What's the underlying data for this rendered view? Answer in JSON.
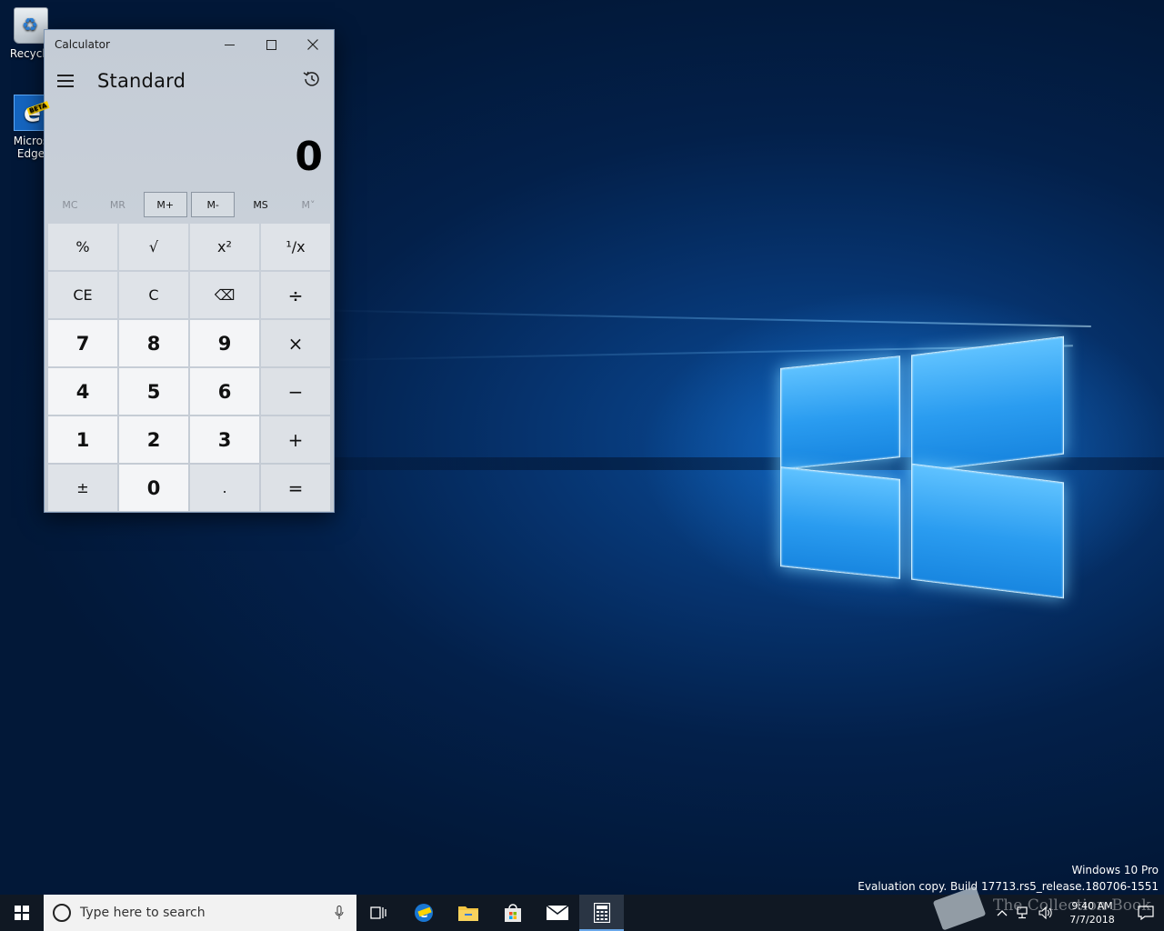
{
  "desktop": {
    "icons": [
      {
        "label": "Recycle",
        "icon": "recycle-bin-icon"
      },
      {
        "label_line1": "Micros",
        "label_line2": "Edge",
        "badge": "BETA",
        "icon": "edge-icon"
      }
    ],
    "watermark": {
      "line1": "Windows 10 Pro",
      "line2": "Evaluation copy. Build 17713.rs5_release.180706-1551"
    }
  },
  "calculator": {
    "window_title": "Calculator",
    "mode": "Standard",
    "display": "0",
    "memory": [
      {
        "label": "MC",
        "enabled": false
      },
      {
        "label": "MR",
        "enabled": false
      },
      {
        "label": "M+",
        "enabled": true
      },
      {
        "label": "M-",
        "enabled": true
      },
      {
        "label": "MS",
        "enabled": true
      },
      {
        "label": "M˅",
        "enabled": false
      }
    ],
    "keys": [
      {
        "label": "%",
        "kind": "fn",
        "name": "percent-key"
      },
      {
        "label": "√",
        "kind": "fn",
        "name": "square-root-key"
      },
      {
        "label": "x²",
        "kind": "fn",
        "name": "square-key"
      },
      {
        "label": "¹/x",
        "kind": "fn",
        "name": "reciprocal-key"
      },
      {
        "label": "CE",
        "kind": "fn",
        "name": "clear-entry-key"
      },
      {
        "label": "C",
        "kind": "fn",
        "name": "clear-key"
      },
      {
        "label": "⌫",
        "kind": "fn",
        "name": "backspace-key"
      },
      {
        "label": "÷",
        "kind": "op",
        "name": "divide-key"
      },
      {
        "label": "7",
        "kind": "num",
        "name": "digit-7-key"
      },
      {
        "label": "8",
        "kind": "num",
        "name": "digit-8-key"
      },
      {
        "label": "9",
        "kind": "num",
        "name": "digit-9-key"
      },
      {
        "label": "×",
        "kind": "op",
        "name": "multiply-key"
      },
      {
        "label": "4",
        "kind": "num",
        "name": "digit-4-key"
      },
      {
        "label": "5",
        "kind": "num",
        "name": "digit-5-key"
      },
      {
        "label": "6",
        "kind": "num",
        "name": "digit-6-key"
      },
      {
        "label": "−",
        "kind": "op",
        "name": "subtract-key"
      },
      {
        "label": "1",
        "kind": "num",
        "name": "digit-1-key"
      },
      {
        "label": "2",
        "kind": "num",
        "name": "digit-2-key"
      },
      {
        "label": "3",
        "kind": "num",
        "name": "digit-3-key"
      },
      {
        "label": "+",
        "kind": "op",
        "name": "add-key"
      },
      {
        "label": "±",
        "kind": "fn",
        "name": "negate-key"
      },
      {
        "label": "0",
        "kind": "num",
        "name": "digit-0-key"
      },
      {
        "label": ".",
        "kind": "fn",
        "name": "decimal-key"
      },
      {
        "label": "=",
        "kind": "op",
        "name": "equals-key"
      }
    ]
  },
  "taskbar": {
    "search_placeholder": "Type here to search",
    "pinned": [
      "task-view-icon",
      "edge-beta-icon",
      "file-explorer-icon",
      "store-icon",
      "mail-icon",
      "calculator-icon"
    ],
    "active_app": "calculator-icon",
    "clock_time": "9:40 AM",
    "clock_date": "7/7/2018",
    "overlay_text": "The Collection Book"
  },
  "colors": {
    "accent": "#6aa8ea",
    "taskbar": "#101823",
    "calc_bg": "#c4ccd6"
  }
}
